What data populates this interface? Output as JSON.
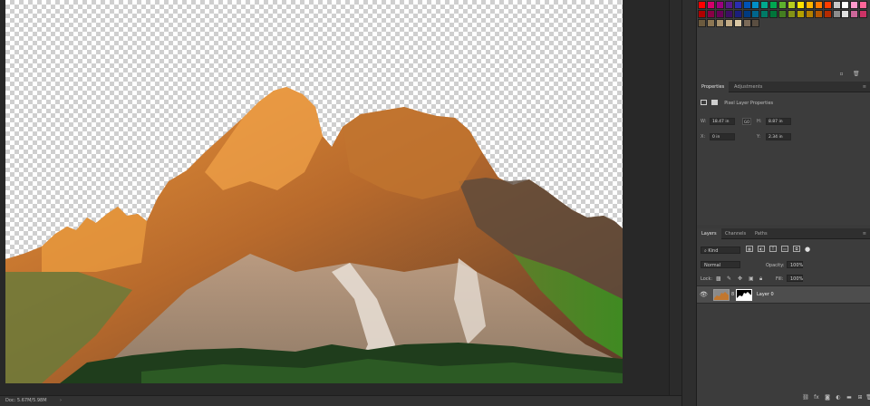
{
  "status": {
    "doc_info": "Doc: 5.67M/5.98M"
  },
  "swatches": {
    "row1": [
      "#ff0000",
      "#d4006a",
      "#9b007f",
      "#5a1a8b",
      "#2b2db0",
      "#0053b7",
      "#008fc7",
      "#00a98f",
      "#00a651",
      "#5db12e",
      "#b7cc1f",
      "#ffe100",
      "#ffb400",
      "#ff7a00",
      "#ff3d00",
      "#c8c8c8",
      "#ffffff",
      "#ff99cc",
      "#ff6699"
    ],
    "row2": [
      "#b00000",
      "#8a0045",
      "#6a0058",
      "#3d0f63",
      "#1b1f7c",
      "#003a80",
      "#00668c",
      "#007a66",
      "#00753a",
      "#447e21",
      "#839216",
      "#b3a000",
      "#b37f00",
      "#b35600",
      "#b32b00",
      "#8c8c8c",
      "#e0e0e0",
      "#cc6699",
      "#cc3366"
    ],
    "row3": [
      "#6b5a3e",
      "#8c7653",
      "#a8926d",
      "#c2ab86",
      "#d9c7a4",
      "#7b6a58",
      "#5a4e41"
    ]
  },
  "properties": {
    "tabs": [
      "Properties",
      "Adjustments"
    ],
    "title": "Pixel Layer Properties",
    "w_label": "W:",
    "w_value": "18.47 in",
    "go_label": "GO",
    "h_label": "H:",
    "h_value": "8.87 in",
    "x_label": "X:",
    "x_value": "0 in",
    "y_label": "Y:",
    "y_value": "2.34 in"
  },
  "layers": {
    "tabs": [
      "Layers",
      "Channels",
      "Paths"
    ],
    "filter_kind": "Kind",
    "blend_mode": "Normal",
    "opacity_label": "Opacity:",
    "opacity_value": "100%",
    "lock_label": "Lock:",
    "fill_label": "Fill:",
    "fill_value": "100%",
    "layer_name": "Layer 0"
  },
  "icons": {
    "eye": "eye-icon",
    "footer": [
      "link-layers-icon",
      "fx-icon",
      "add-mask-icon",
      "adjustment-layer-icon",
      "group-icon",
      "new-layer-icon",
      "delete-icon"
    ]
  }
}
